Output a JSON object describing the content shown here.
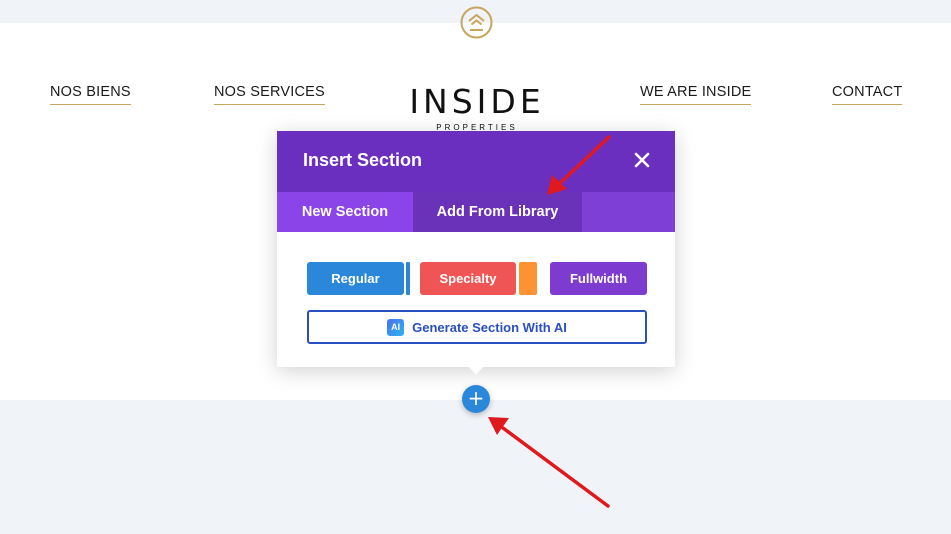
{
  "nav": {
    "links": [
      "NOS BIENS",
      "NOS SERVICES",
      "WE ARE INSIDE",
      "CONTACT"
    ]
  },
  "brand": {
    "name": "INSIDE",
    "tagline": "PROPERTIES"
  },
  "modal": {
    "title": "Insert Section",
    "close_icon": "close-icon",
    "tabs": [
      "New Section",
      "Add From Library"
    ],
    "active_tab": "New Section",
    "buttons": {
      "regular": "Regular",
      "specialty": "Specialty",
      "fullwidth": "Fullwidth"
    },
    "ai": {
      "badge": "AI",
      "label": "Generate Section With AI"
    }
  },
  "add_button": {
    "symbol": "+",
    "icon": "plus-icon"
  },
  "colors": {
    "modal_header": "#6b2fbf",
    "tab_active": "#8a44e8",
    "regular": "#2b87da",
    "specialty": "#ef5555",
    "specialty_accent": "#ff9232",
    "fullwidth": "#7e3bd0",
    "ai_border": "#2a4fc0",
    "nav_underline": "#c9a45c",
    "annotation_arrow": "#e0191e"
  }
}
